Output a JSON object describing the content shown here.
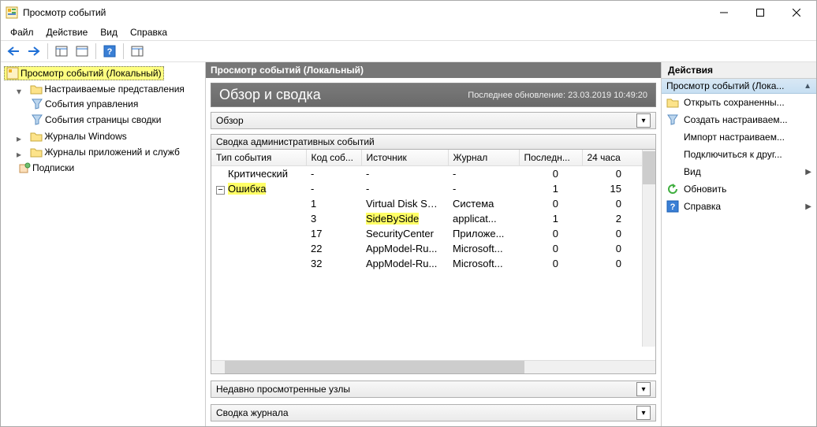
{
  "window": {
    "title": "Просмотр событий"
  },
  "menu": {
    "file": "Файл",
    "action": "Действие",
    "view": "Вид",
    "help": "Справка"
  },
  "tree": {
    "root": "Просмотр событий (Локальный)",
    "custom_views": "Настраиваемые представления",
    "admin_events": "События управления",
    "summary_page_events": "События страницы сводки",
    "win_logs": "Журналы Windows",
    "app_service_logs": "Журналы приложений и служб",
    "subscriptions": "Подписки"
  },
  "center": {
    "header": "Просмотр событий (Локальный)",
    "summary_title": "Обзор и сводка",
    "last_refresh": "Последнее обновление: 23.03.2019 10:49:20",
    "overview_label": "Обзор",
    "admin_summary_label": "Сводка административных событий",
    "recent_nodes_label": "Недавно просмотренные узлы",
    "log_summary_label": "Сводка журнала",
    "cols": {
      "type": "Тип события",
      "id": "Код соб...",
      "source": "Источник",
      "log": "Журнал",
      "last": "Последн...",
      "h24": "24 часа"
    },
    "rows": [
      {
        "type": "Критический",
        "id": "-",
        "source": "-",
        "log": "-",
        "h24": "0",
        "sum": "0"
      },
      {
        "type": "Ошибка",
        "id": "-",
        "source": "-",
        "log": "-",
        "h24": "1",
        "sum": "15",
        "hl": true,
        "exp": true
      },
      {
        "type": "",
        "id": "1",
        "source": "Virtual Disk Ser...",
        "log": "Система",
        "h24": "0",
        "sum": "0"
      },
      {
        "type": "",
        "id": "3",
        "source": "SideBySide",
        "log": "applicat...",
        "h24": "1",
        "sum": "2",
        "hl_src": true
      },
      {
        "type": "",
        "id": "17",
        "source": "SecurityCenter",
        "log": "Приложе...",
        "h24": "0",
        "sum": "0"
      },
      {
        "type": "",
        "id": "22",
        "source": "AppModel-Ru...",
        "log": "Microsoft...",
        "h24": "0",
        "sum": "0"
      },
      {
        "type": "",
        "id": "32",
        "source": "AppModel-Ru...",
        "log": "Microsoft...",
        "h24": "0",
        "sum": "0"
      }
    ]
  },
  "actions": {
    "header": "Действия",
    "group": "Просмотр событий (Лока...",
    "open": "Открыть сохраненны...",
    "create": "Создать настраиваем...",
    "import": "Импорт настраиваем...",
    "connect": "Подключиться к друг...",
    "view": "Вид",
    "refresh": "Обновить",
    "help": "Справка"
  }
}
